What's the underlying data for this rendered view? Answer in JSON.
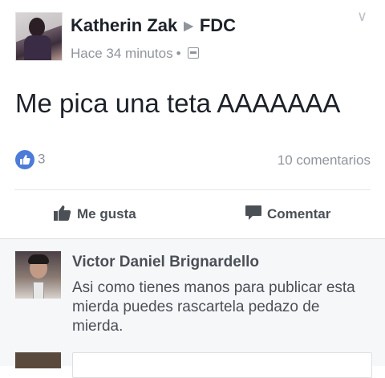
{
  "post": {
    "author": "Katherin Zak",
    "target_group": "FDC",
    "time": "Hace 34 minutos",
    "text": "Me pica una teta AAAAAAA",
    "reaction_count": "3",
    "comments_count": "10 comentarios"
  },
  "actions": {
    "like_label": "Me gusta",
    "comment_label": "Comentar"
  },
  "comment": {
    "author": "Victor Daniel Brignardello",
    "text": "Asi como tienes manos para publicar esta mierda puedes rascartela pedazo de mierda."
  },
  "colors": {
    "accent": "#4c7bd8",
    "muted": "#90949c",
    "text": "#1d2129",
    "comment_bg": "#f6f7f9"
  },
  "icons": [
    "chevron-down-icon",
    "audience-icon",
    "like-badge-icon",
    "thumbs-up-icon",
    "comment-icon"
  ]
}
